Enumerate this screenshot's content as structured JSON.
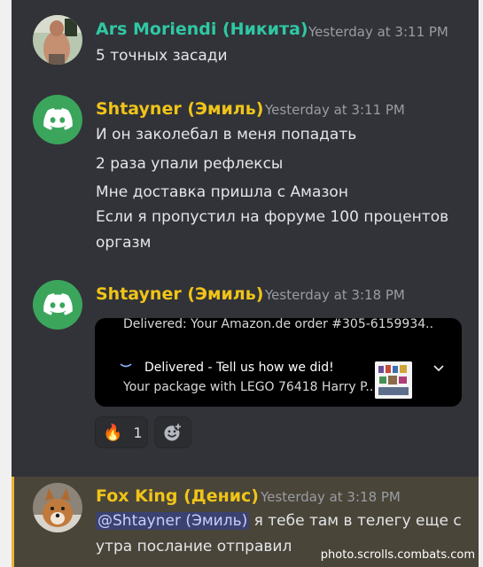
{
  "colors": {
    "background": "#313338",
    "username_ars": "#2fc8a4",
    "username_shtayner": "#f0c419",
    "username_fox": "#f0c419",
    "highlight_bg": "#4a4539",
    "highlight_bar": "#f0b232",
    "mention_bg": "#3c4270"
  },
  "messages": [
    {
      "author": "Ars Moriendi (Никита)",
      "time": "Yesterday at 3:11 PM",
      "avatar": "user-photo",
      "lines": [
        "5 точных засади"
      ]
    },
    {
      "author": "Shtayner (Эмиль)",
      "time": "Yesterday at 3:11 PM",
      "avatar": "discord-logo-icon",
      "lines": [
        "И он заколебал в меня попадать",
        "2 раза упали рефлексы",
        "Мне доставка пришла с Амазон",
        "Если я пропустил на форуме 100 процентов",
        "оргазм"
      ]
    },
    {
      "author": "Shtayner (Эмиль)",
      "time": "Yesterday at 3:18 PM",
      "avatar": "discord-logo-icon",
      "embed": {
        "header": "Delivered: Your Amazon.de order #305-6159934..",
        "title": "Delivered - Tell us how we did!",
        "subtitle": "Your package with LEGO 76418 Harry P..",
        "icons": [
          "amazon-smile-icon",
          "product-thumbnail",
          "chevron-down-icon"
        ]
      },
      "reactions": [
        {
          "emoji": "🔥",
          "count": "1",
          "icon": "fire-emoji"
        },
        {
          "emoji": "",
          "count": "",
          "icon": "add-reaction-icon"
        }
      ]
    },
    {
      "author": "Fox King (Денис)",
      "time": "Yesterday at 3:18 PM",
      "avatar": "dog-photo",
      "mention": "@Shtayner (Эмиль)",
      "text_after_mention": " я тебе там в телегу еще с",
      "line2": "утра послание отправил"
    }
  ],
  "watermark": "photo.scrolls.combats.com"
}
